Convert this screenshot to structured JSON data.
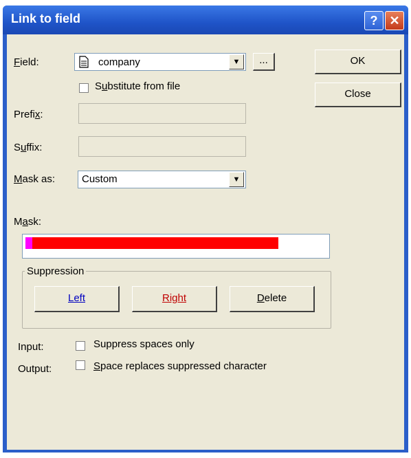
{
  "window": {
    "title": "Link to field",
    "help_glyph": "?",
    "close_glyph": "✕"
  },
  "field": {
    "label": "Field:",
    "value": "company",
    "browse_label": "...",
    "substitute_label": "Substitute from file"
  },
  "prefix": {
    "label": "Prefix:",
    "value": ""
  },
  "suffix": {
    "label": "Suffix:",
    "value": ""
  },
  "mask_as": {
    "label": "Mask as:",
    "value": "Custom"
  },
  "mask": {
    "label": "Mask:",
    "fill_fraction": 0.84,
    "colors": {
      "magenta": "#ff00ff",
      "red": "#ff0000"
    }
  },
  "suppression": {
    "title": "Suppression",
    "left_label": "Left",
    "right_label": "Right",
    "delete_label": "Delete",
    "colors": {
      "left": "#0000c0",
      "right": "#c00000"
    }
  },
  "input_row": {
    "label": "Input:",
    "option": "Suppress spaces only"
  },
  "output_row": {
    "label": "Output:",
    "option": "Space replaces suppressed character"
  },
  "buttons": {
    "ok": "OK",
    "close": "Close"
  },
  "icons": {
    "field_icon": "document-icon"
  }
}
